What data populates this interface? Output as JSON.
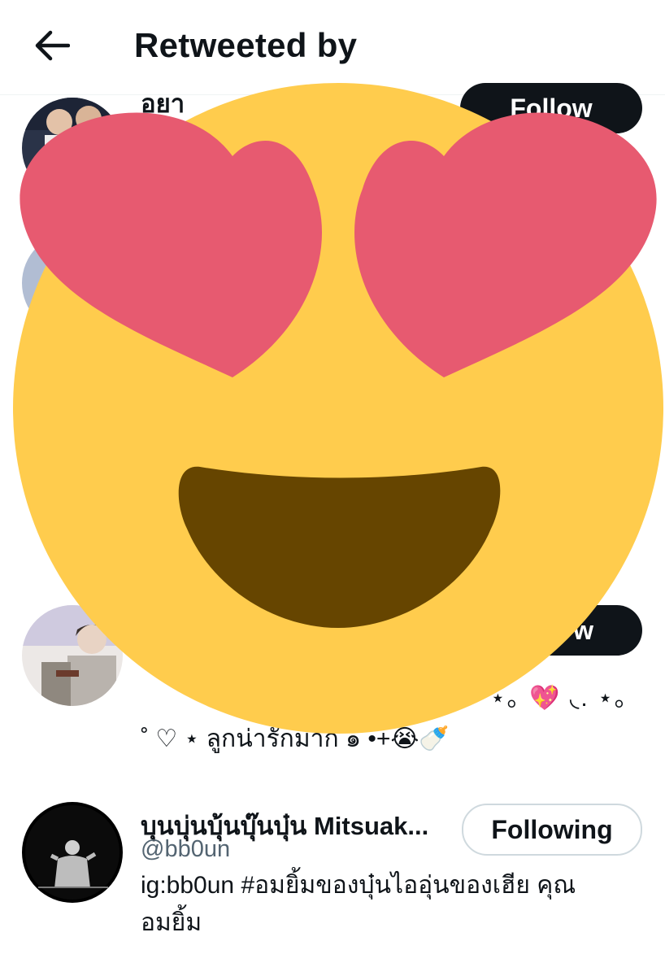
{
  "header": {
    "title": "Retweeted by",
    "back_icon": "arrow-left-icon"
  },
  "users": [
    {
      "name": "อยา",
      "handle": "@",
      "button_label": "Follow"
    },
    {
      "name": "",
      "handle": "",
      "bio_line1": "⋆｡ 💖 ◟. ⋆｡",
      "bio_line2": "˚ ♡ ⋆ ลูกน่ารักมาก ๑ •+😭🍼",
      "button_label": "w"
    },
    {
      "name": "บุนบุ่นบุ้นบุ๊นบุ๋น Mitsuak...",
      "handle": "@bb0un",
      "bio_line1": "ig:bb0un #อมยิ้มของบุ๋นไออุ่นของเฮีย คุณ",
      "bio_line2": "อมยิ้ม",
      "button_label": "Following"
    }
  ],
  "overlay": {
    "emoji": "smiling-face-with-heart-eyes",
    "colors": {
      "face": "#FFCC4D",
      "hearts": "#E75A70",
      "mouth": "#664500"
    }
  },
  "colors": {
    "text_primary": "#0f1419",
    "text_secondary": "#536471",
    "follow_bg": "#0f1419",
    "divider": "#eff3f4"
  }
}
